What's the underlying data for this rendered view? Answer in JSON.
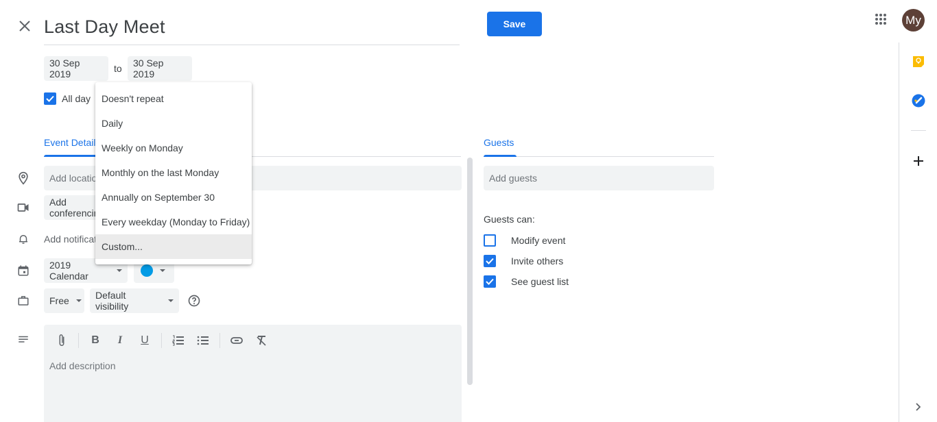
{
  "header": {
    "title": "Last Day Meet",
    "save_label": "Save",
    "avatar_initials": "My",
    "avatar_color": "#5d4037",
    "accent": "#1a73e8"
  },
  "dates": {
    "start": "30 Sep 2019",
    "separator": "to",
    "end": "30 Sep 2019"
  },
  "all_day": {
    "label": "All day",
    "checked": true
  },
  "repeat_menu": {
    "items": [
      {
        "label": "Doesn't repeat"
      },
      {
        "label": "Daily"
      },
      {
        "label": "Weekly on Monday"
      },
      {
        "label": "Monthly on the last Monday"
      },
      {
        "label": "Annually on September 30"
      },
      {
        "label": "Every weekday (Monday to Friday)"
      },
      {
        "label": "Custom...",
        "hovered": true
      }
    ]
  },
  "event_details": {
    "tab_label": "Event Details",
    "location_placeholder": "Add location",
    "conference_label": "Add conferencing",
    "notification_label": "Add notification",
    "calendar_value": "2019 Calendar",
    "color_value": "#039be5",
    "availability_value": "Free",
    "visibility_value": "Default visibility",
    "description_placeholder": "Add description"
  },
  "toolbar": {
    "icons": [
      "attachment-icon",
      "bold-icon",
      "italic-icon",
      "underline-icon",
      "numbered-list-icon",
      "bulleted-list-icon",
      "link-icon",
      "clear-formatting-icon"
    ]
  },
  "guests": {
    "tab_label": "Guests",
    "input_placeholder": "Add guests",
    "permissions_heading": "Guests can:",
    "permissions": [
      {
        "label": "Modify event",
        "checked": false
      },
      {
        "label": "Invite others",
        "checked": true
      },
      {
        "label": "See guest list",
        "checked": true
      }
    ]
  },
  "side_panel": {
    "icons": [
      "keep-icon",
      "tasks-icon",
      "add-icon",
      "chevron-right-icon"
    ]
  }
}
